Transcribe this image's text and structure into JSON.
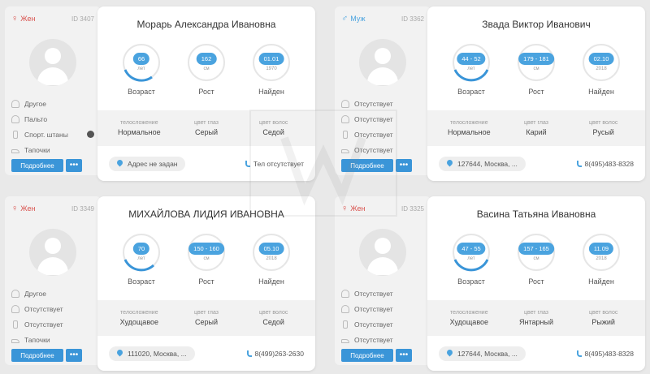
{
  "accent_color": "#4aa3df",
  "profiles": [
    {
      "gender_symbol": "♀",
      "gender": "Жен",
      "id": "ID 3407",
      "clothing": [
        "Другое",
        "Пальто",
        "Спорт. штаны",
        "Тапочки"
      ],
      "more_label": "Подробнее",
      "dots_label": "•••",
      "name": "Морарь Александра Ивановна",
      "age": "66",
      "age_unit": "лет",
      "age_label": "Возраст",
      "height": "162",
      "height_unit": "см",
      "height_label": "Рост",
      "found": "01.01",
      "found_year": "1970",
      "found_label": "Найден",
      "build_caption": "телосложение",
      "build": "Нормальное",
      "eyes_caption": "цвет глаз",
      "eyes": "Серый",
      "hair_caption": "цвет волос",
      "hair": "Седой",
      "address": "Адрес не задан",
      "phone": "Тел отсутствует"
    },
    {
      "gender_symbol": "♂",
      "gender": "Муж",
      "id": "ID 3362",
      "clothing": [
        "Отсутствует",
        "Отсутствует",
        "Отсутствует",
        "Отсутствует"
      ],
      "more_label": "Подробнее",
      "dots_label": "•••",
      "name": "Звада Виктор Иванович",
      "age": "44 - 52",
      "age_unit": "лет",
      "age_label": "Возраст",
      "height": "179 - 181",
      "height_unit": "см",
      "height_label": "Рост",
      "found": "02.10",
      "found_year": "2018",
      "found_label": "Найден",
      "build_caption": "телосложение",
      "build": "Нормальное",
      "eyes_caption": "цвет глаз",
      "eyes": "Карий",
      "hair_caption": "цвет волос",
      "hair": "Русый",
      "address": "127644, Москва, ...",
      "phone": "8(495)483-8328"
    },
    {
      "gender_symbol": "♀",
      "gender": "Жен",
      "id": "ID 3349",
      "clothing": [
        "Другое",
        "Отсутствует",
        "Отсутствует",
        "Тапочки"
      ],
      "more_label": "Подробнее",
      "dots_label": "•••",
      "name": "МИХАЙЛОВА ЛИДИЯ ИВАНОВНА",
      "age": "70",
      "age_unit": "лет",
      "age_label": "Возраст",
      "height": "150 - 160",
      "height_unit": "см",
      "height_label": "Рост",
      "found": "05.10",
      "found_year": "2018",
      "found_label": "Найден",
      "build_caption": "телосложение",
      "build": "Худощавое",
      "eyes_caption": "цвет глаз",
      "eyes": "Серый",
      "hair_caption": "цвет волос",
      "hair": "Седой",
      "address": "111020, Москва, ...",
      "phone": "8(499)263-2630"
    },
    {
      "gender_symbol": "♀",
      "gender": "Жен",
      "id": "ID 3325",
      "clothing": [
        "Отсутствует",
        "Отсутствует",
        "Отсутствует",
        "Отсутствует"
      ],
      "more_label": "Подробнее",
      "dots_label": "•••",
      "name": "Васина Татьяна Ивановна",
      "age": "47 - 55",
      "age_unit": "лет",
      "age_label": "Возраст",
      "height": "157 - 165",
      "height_unit": "см",
      "height_label": "Рост",
      "found": "11.09",
      "found_year": "2018",
      "found_label": "Найден",
      "build_caption": "телосложение",
      "build": "Худощавое",
      "eyes_caption": "цвет глаз",
      "eyes": "Янтарный",
      "hair_caption": "цвет волос",
      "hair": "Рыжий",
      "address": "127644, Москва, ...",
      "phone": "8(495)483-8328"
    }
  ]
}
